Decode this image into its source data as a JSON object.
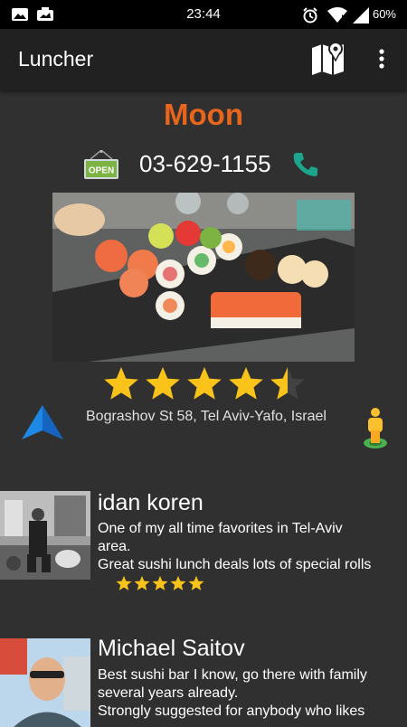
{
  "status_bar": {
    "time": "23:44",
    "battery": "60%"
  },
  "app_bar": {
    "title": "Luncher",
    "map_icon": "map-icon",
    "more_icon": "more-vert-icon"
  },
  "restaurant": {
    "name": "Moon",
    "open_badge": "OPEN",
    "phone": "03-629-1155",
    "rating": 4.5,
    "address": "Bograshov St 58, Tel Aviv-Yafo, Israel"
  },
  "reviews": [
    {
      "author": "idan koren",
      "text_lines": [
        "One of my all time favorites in Tel-Aviv",
        "area.",
        "Great sushi lunch deals lots of special rolls"
      ],
      "rating": 5
    },
    {
      "author": "Michael Saitov",
      "text_lines": [
        "Best sushi bar I know,  go there with family",
        "several years already.",
        "Strongly suggested for anybody who likes"
      ],
      "rating": null
    }
  ],
  "colors": {
    "accent": "#e8661c",
    "phone_icon": "#1aa58c",
    "star": "#f9c31a",
    "nav": "#1e88e5"
  }
}
